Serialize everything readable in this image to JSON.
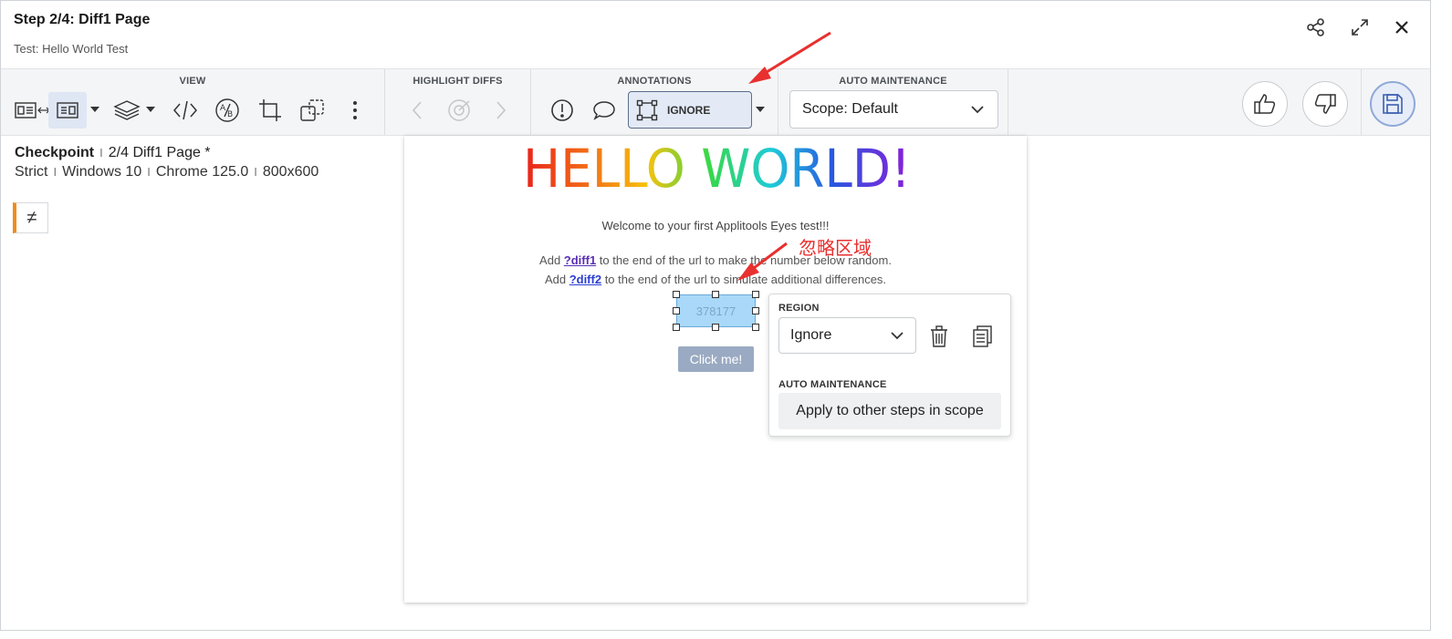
{
  "header": {
    "title": "Step 2/4:  Diff1 Page",
    "subtitle": "Test: Hello World Test",
    "icons": [
      "share-icon",
      "expand-icon",
      "close-icon"
    ]
  },
  "toolbar": {
    "view_label": "VIEW",
    "highlight_label": "HIGHLIGHT DIFFS",
    "annotations_label": "ANNOTATIONS",
    "auto_maintenance_label": "AUTO MAINTENANCE",
    "annotation_mode": "IGNORE",
    "scope_value": "Scope: Default"
  },
  "checkpoint": {
    "label": "Checkpoint",
    "name": "2/4 Diff1 Page *",
    "match_level": "Strict",
    "os": "Windows 10",
    "browser": "Chrome 125.0",
    "viewport": "800x600",
    "diff_symbol": "≠"
  },
  "page": {
    "heading": "HELLO WORLD!",
    "welcome": "Welcome to your first Applitools Eyes test!!!",
    "line1_pre": "Add ",
    "line1_link": "?diff1",
    "line1_post": " to the end of the url to make the number below random.",
    "line2_pre": "Add ",
    "line2_link": "?diff2",
    "line2_post": " to the end of the url to simulate additional differences.",
    "number": "378177",
    "button": "Click me!"
  },
  "popover": {
    "region_label": "REGION",
    "region_value": "Ignore",
    "auto_maintenance_label": "AUTO MAINTENANCE",
    "apply_label": "Apply to other steps in scope"
  },
  "annotation_note": "忽略区域",
  "colors": {
    "accent": "#f08c1e",
    "annotation_red": "#e8302f",
    "ignore_region": "#a9d8f8",
    "save_blue": "#3b5fb0"
  }
}
